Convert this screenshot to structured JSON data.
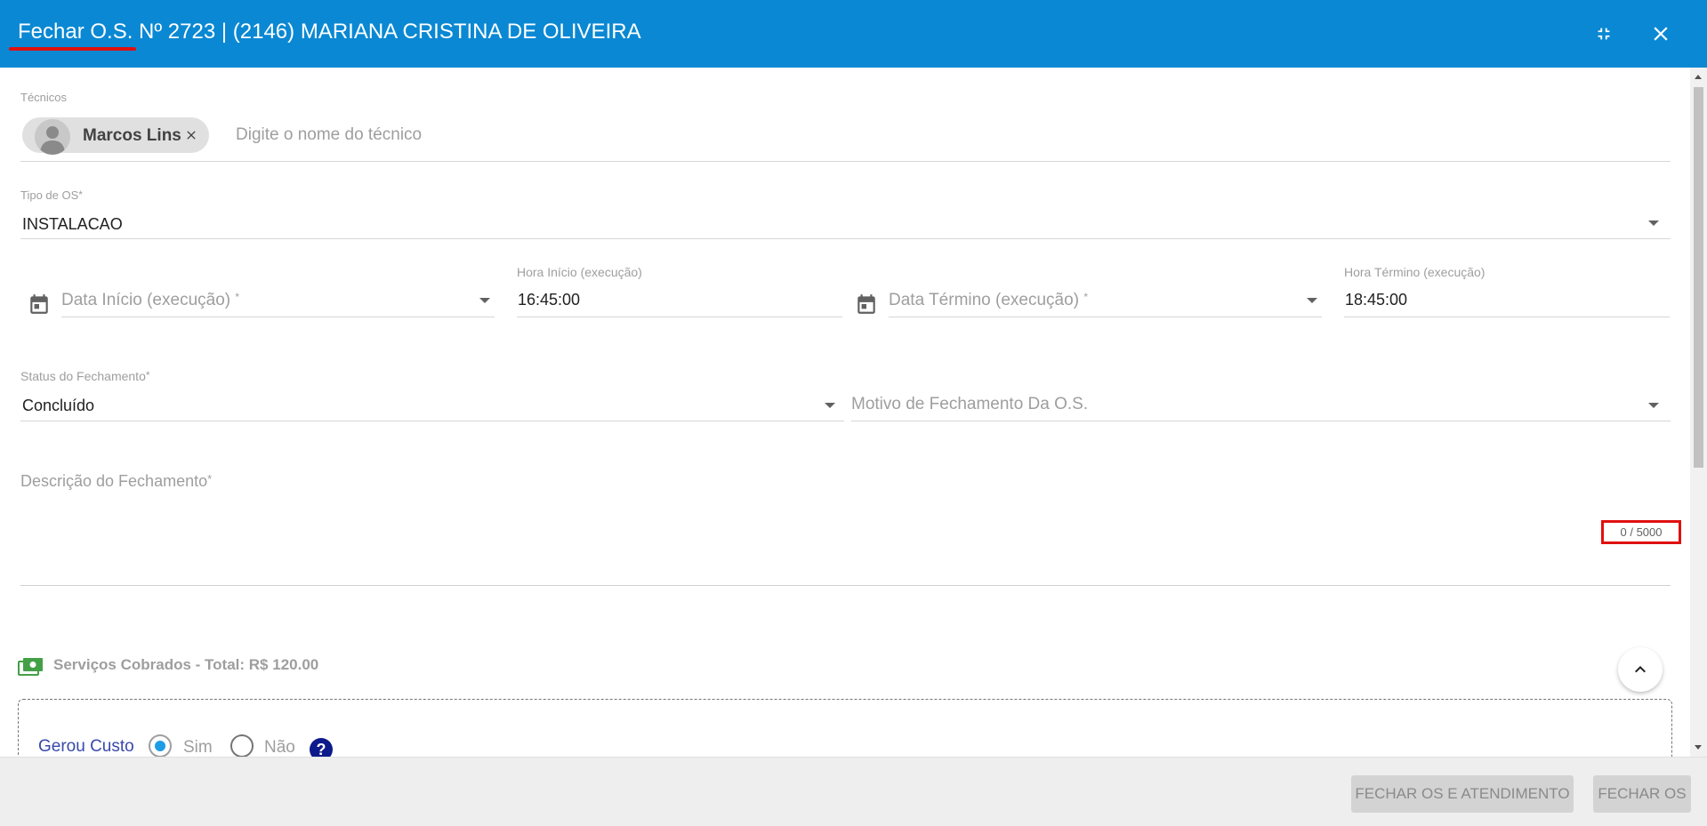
{
  "header": {
    "title": "Fechar O.S. Nº 2723 | (2146) MARIANA CRISTINA DE OLIVEIRA",
    "minimize_icon": "exit-fullscreen-icon",
    "close_icon": "close-icon"
  },
  "form": {
    "tecnicos": {
      "label": "Técnicos",
      "chip_label": "Marcos Lins",
      "placeholder": "Digite o nome do técnico"
    },
    "tipo_os": {
      "label": "Tipo de OS",
      "required": "*",
      "value": "INSTALACAO"
    },
    "data_inicio": {
      "label": "Data Início (execução)",
      "required": "*"
    },
    "hora_inicio": {
      "label": "Hora Início (execução)",
      "value": "16:45:00"
    },
    "data_termino": {
      "label": "Data Término (execução)",
      "required": "*"
    },
    "hora_termino": {
      "label": "Hora Término (execução)",
      "value": "18:45:00"
    },
    "status_fechamento": {
      "label": "Status do Fechamento",
      "required": "*",
      "value": "Concluído"
    },
    "motivo_fechamento": {
      "label": "Motivo de Fechamento Da O.S."
    },
    "descricao": {
      "label": "Descrição do Fechamento",
      "required": "*",
      "counter": "0 / 5000"
    }
  },
  "servicos": {
    "title": "Serviços Cobrados - Total: R$ 120.00",
    "gerou_custo": {
      "label": "Gerou Custo",
      "options": [
        "Sim",
        "Não"
      ],
      "selected": "Sim",
      "help": "?"
    }
  },
  "footer": {
    "fechar_os_atendimento": "FECHAR OS E ATENDIMENTO",
    "fechar_os": "FECHAR OS"
  },
  "colors": {
    "header_bg": "#0a88d3",
    "accent": "#1e9ce6",
    "highlight": "#e01010"
  }
}
